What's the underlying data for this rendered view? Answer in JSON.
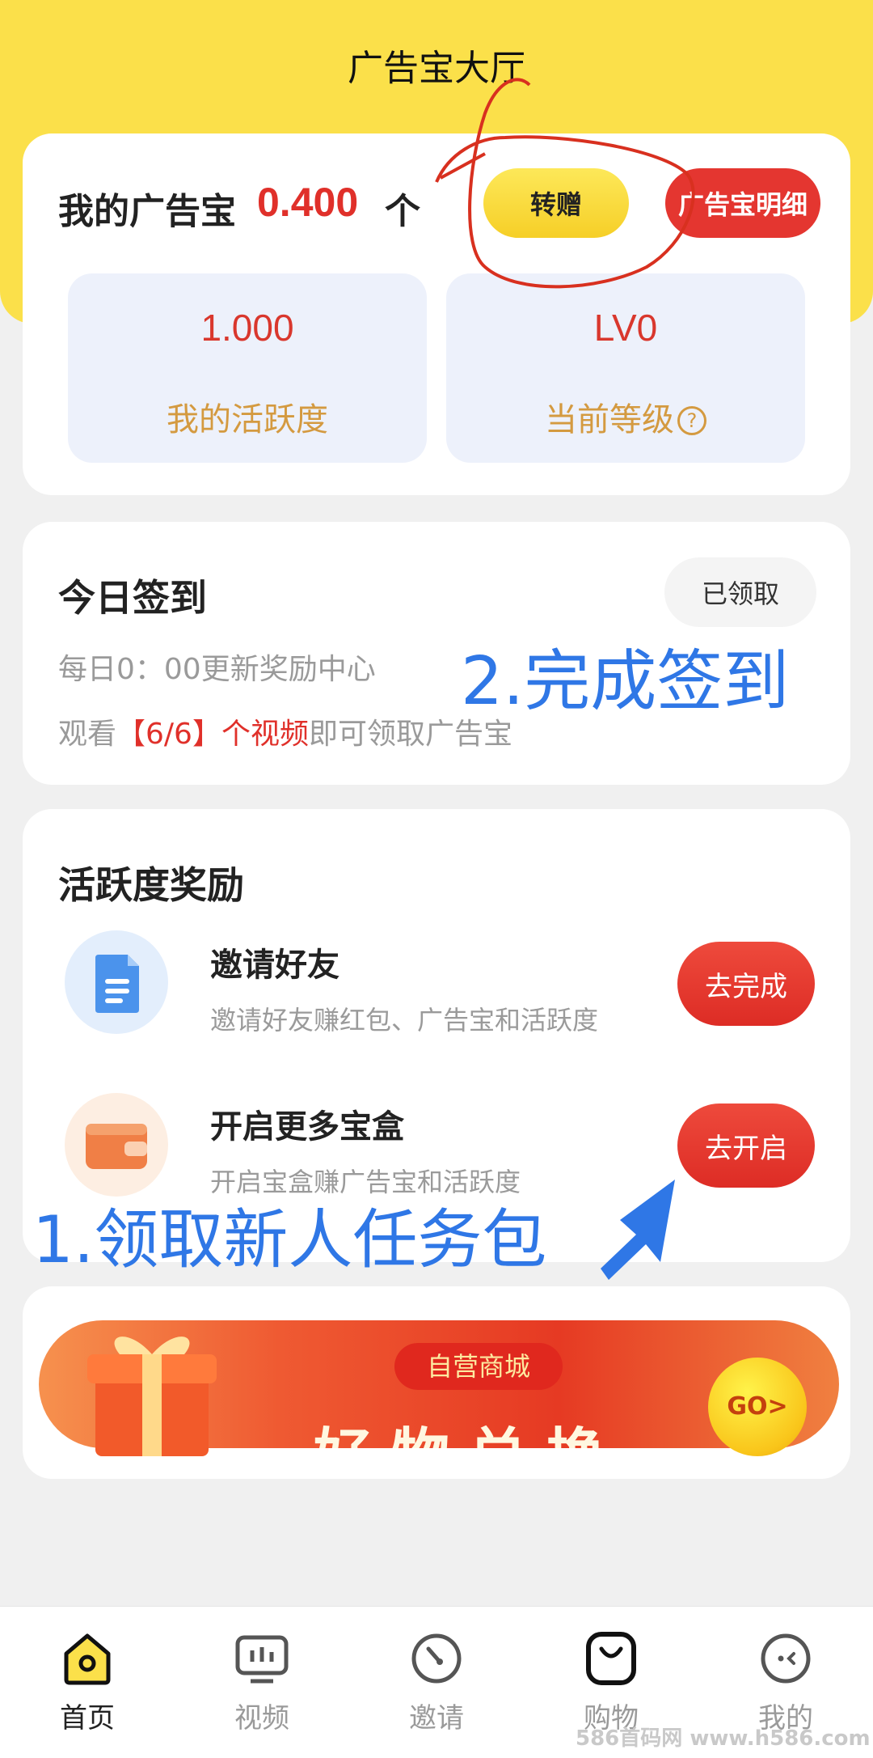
{
  "header": {
    "title": "广告宝大厅"
  },
  "balance": {
    "label": "我的广告宝",
    "value": "0.400",
    "unit": "个",
    "transfer_button": "转赠",
    "detail_button": "广告宝明细"
  },
  "stats": {
    "activity": {
      "value": "1.000",
      "label": "我的活跃度"
    },
    "level": {
      "value": "LV0",
      "label": "当前等级",
      "help_icon": "?"
    }
  },
  "signin": {
    "title": "今日签到",
    "button": "已领取",
    "desc1": "每日0：00更新奖励中心",
    "desc2_prefix": "观看",
    "desc2_highlight": "【6/6】个视频",
    "desc2_suffix": "即可领取广告宝"
  },
  "activity_rewards": {
    "title": "活跃度奖励",
    "tasks": [
      {
        "name": "邀请好友",
        "desc": "邀请好友赚红包、广告宝和活跃度",
        "button": "去完成",
        "icon": "document-icon"
      },
      {
        "name": "开启更多宝盒",
        "desc": "开启宝盒赚广告宝和活跃度",
        "button": "去开启",
        "icon": "wallet-icon"
      }
    ]
  },
  "banner": {
    "tag": "自营商城",
    "main": "好物兑换",
    "go": "GO>"
  },
  "annotations": {
    "step1": "1.领取新人任务包",
    "step2": "2.完成签到"
  },
  "tabbar": {
    "items": [
      {
        "label": "首页",
        "icon": "home-icon",
        "active": true
      },
      {
        "label": "视频",
        "icon": "video-icon",
        "active": false
      },
      {
        "label": "邀请",
        "icon": "invite-icon",
        "active": false
      },
      {
        "label": "购物",
        "icon": "shopping-bag-icon",
        "active": false
      },
      {
        "label": "我的",
        "icon": "profile-icon",
        "active": false
      }
    ]
  },
  "watermark": "586首码网 www.h586.com",
  "colors": {
    "header_yellow": "#fbe04a",
    "accent_red": "#e43630",
    "annotation_blue": "#2f77e6",
    "stat_orange": "#d49a40"
  }
}
